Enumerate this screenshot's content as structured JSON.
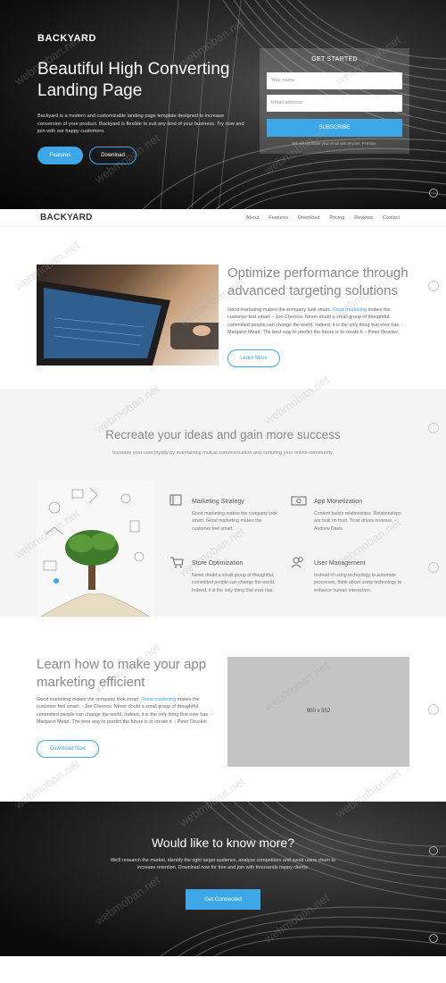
{
  "hero": {
    "logo": "BACKYARD",
    "title_line1": "Beautiful High Converting",
    "title_line2": "Landing Page",
    "description": "Backyard is a modern and customizable landing page template designed to increase conversion of your product. Backyard is flexible to suit any kind of your business. Try now and join with our happy customers.",
    "btn_features": "Features",
    "btn_download": "Download",
    "form": {
      "title": "GET STARTED",
      "name_placeholder": "Your name",
      "email_placeholder": "Email address",
      "submit_label": "SUBSCRIBE",
      "note": "We will not share your email with anyone. Promise."
    }
  },
  "nav": {
    "logo": "BACKYARD",
    "links": [
      "About",
      "Features",
      "Download",
      "Pricing",
      "Reviews",
      "Contact"
    ]
  },
  "section1": {
    "title": "Optimize performance through advanced targeting solutions",
    "desc_before": "Good marketing makes the company look smart. ",
    "desc_link": "Great marketing",
    "desc_after": " makes the customer feel smart. - Joe Chernov. Never doubt a small group of thoughtful, committed people can change the world. Indeed, it is the only thing that ever has. - Margaret Mead. The best way to predict the future is to create it. - Peter Drucker.",
    "button": "Learn More"
  },
  "section2": {
    "title": "Recreate your ideas and gain more success",
    "subtitle": "Increase your user loyalty by maintaining mutual communication and nurturing your online community.",
    "features": [
      {
        "title": "Marketing Strategy",
        "text": "Good marketing makes the company look smart. Great marketing makes the customer feel smart."
      },
      {
        "title": "App Monetization",
        "text": "Content builds relationships. Relationships are built on trust. Trust drives revenue. - Andrew Davis"
      },
      {
        "title": "Store Optimization",
        "text": "Never doubt a small group of thoughtful, committed people can change the world. Indeed, it is the only thing that ever has."
      },
      {
        "title": "User Management",
        "text": "Instead of using technology to automate processes, think about using technology to enhance human interaction."
      }
    ]
  },
  "section3": {
    "title": "Learn how to make your app marketing efficient",
    "desc_before": "Good marketing makes the company look smart. ",
    "desc_link": "Great marketing",
    "desc_after": " makes the customer feel smart. - Joe Chernov. Never doubt a small group of thoughtful, committed people can change the world. Indeed, it is the only thing that ever has. - Margaret Mead. The best way to predict the future is to create it. - Peter Drucker.",
    "button": "Download Now",
    "placeholder_label": "900 x 552"
  },
  "cta": {
    "title": "Would like to know more?",
    "desc": "We'll research the market, identify the right target audience, analyze competitors and avoid users churn to increase retention. Download now for free and join with thousands happy clients.",
    "button": "Get Connected"
  },
  "watermark": "webmoban.net",
  "colors": {
    "accent": "#3ea7e8",
    "hero_bg": "#111111",
    "section_grey": "#f4f4f4"
  }
}
